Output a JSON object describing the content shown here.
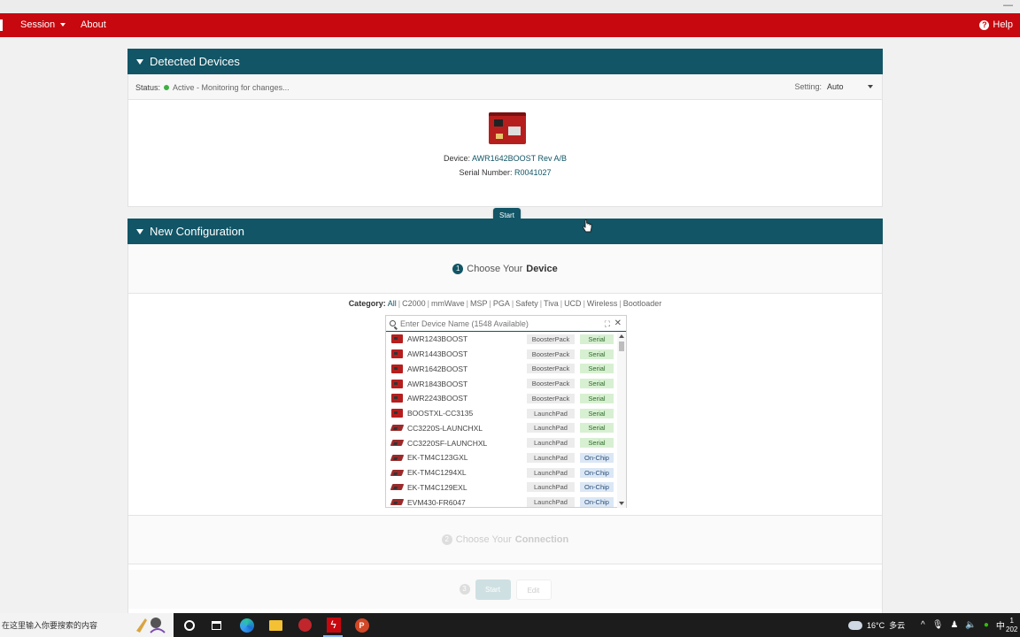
{
  "menubar": {
    "items": [
      {
        "label": "Session"
      },
      {
        "label": "About"
      }
    ],
    "help_label": "Help"
  },
  "detected_devices": {
    "title": "Detected Devices",
    "status_label": "Status:",
    "status_text": "Active - Monitoring for changes...",
    "setting_label": "Setting:",
    "setting_value": "Auto",
    "device_label": "Device:",
    "device_value": "AWR1642BOOST Rev A/B",
    "serial_label": "Serial Number:",
    "serial_value": "R0041027",
    "start_label": "Start"
  },
  "new_configuration": {
    "title": "New Configuration",
    "step1": {
      "num": "1",
      "prefix": "Choose Your",
      "bold": "Device"
    },
    "category_label": "Category:",
    "categories": [
      "All",
      "C2000",
      "mmWave",
      "MSP",
      "PGA",
      "Safety",
      "Tiva",
      "UCD",
      "Wireless",
      "Bootloader"
    ],
    "active_category": "All",
    "search_placeholder": "Enter Device Name (1548 Available)",
    "devices": [
      {
        "name": "AWR1243BOOST",
        "kind": "BoosterPack",
        "conn": "Serial"
      },
      {
        "name": "AWR1443BOOST",
        "kind": "BoosterPack",
        "conn": "Serial"
      },
      {
        "name": "AWR1642BOOST",
        "kind": "BoosterPack",
        "conn": "Serial"
      },
      {
        "name": "AWR1843BOOST",
        "kind": "BoosterPack",
        "conn": "Serial"
      },
      {
        "name": "AWR2243BOOST",
        "kind": "BoosterPack",
        "conn": "Serial"
      },
      {
        "name": "BOOSTXL-CC3135",
        "kind": "LaunchPad",
        "conn": "Serial"
      },
      {
        "name": "CC3220S-LAUNCHXL",
        "kind": "LaunchPad",
        "conn": "Serial"
      },
      {
        "name": "CC3220SF-LAUNCHXL",
        "kind": "LaunchPad",
        "conn": "Serial"
      },
      {
        "name": "EK-TM4C123GXL",
        "kind": "LaunchPad",
        "conn": "On-Chip"
      },
      {
        "name": "EK-TM4C1294XL",
        "kind": "LaunchPad",
        "conn": "On-Chip"
      },
      {
        "name": "EK-TM4C129EXL",
        "kind": "LaunchPad",
        "conn": "On-Chip"
      },
      {
        "name": "EVM430-FR6047",
        "kind": "LaunchPad",
        "conn": "On-Chip"
      }
    ],
    "step2": {
      "num": "2",
      "prefix": "Choose Your",
      "bold": "Connection"
    },
    "step3": {
      "num": "3",
      "start_label": "Start",
      "edit_label": "Edit"
    }
  },
  "taskbar": {
    "search_placeholder": "在这里输入你要搜索的内容",
    "weather_temp": "16°C",
    "weather_desc": "多云",
    "ime": "中",
    "clock_partial_top": "1",
    "clock_partial_bottom": "202"
  },
  "colors": {
    "brand_red": "#c8080f",
    "header_teal": "#115566",
    "status_green": "#3cb043"
  }
}
